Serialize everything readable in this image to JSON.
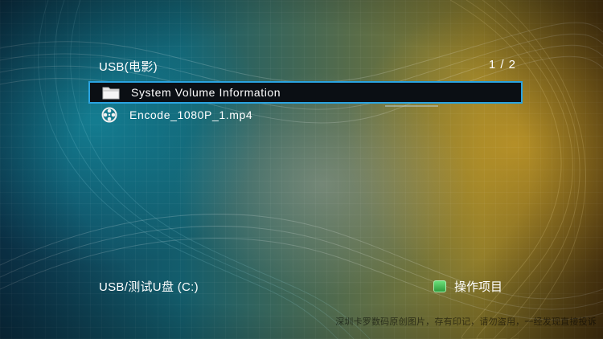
{
  "header": {
    "title": "USB(电影)",
    "page_indicator": "1 / 2"
  },
  "file_list": {
    "items": [
      {
        "name": "System Volume Information",
        "icon": "folder-icon",
        "selected": true
      },
      {
        "name": "Encode_1080P_1.mp4",
        "icon": "film-reel-icon",
        "selected": false
      }
    ]
  },
  "footer": {
    "device": "USB/测试U盘 (C:)",
    "action_label": "操作项目",
    "action_key_icon": "green-key-icon",
    "action_key_color": "#3fbf50"
  },
  "watermark": "深圳卡罗数码原创图片，存有印记，请勿盗用，一经发现直接投诉",
  "colors": {
    "selection_border": "#2aa3e0",
    "selection_bg": "#0b0f14"
  }
}
